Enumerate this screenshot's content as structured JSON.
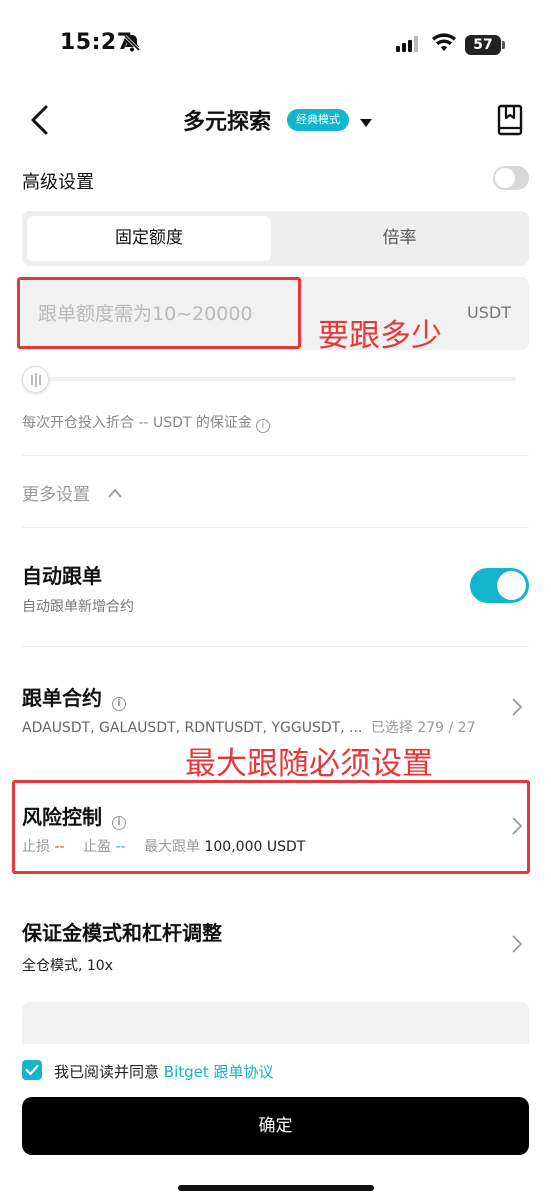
{
  "status": {
    "time": "15:27",
    "battery": "57"
  },
  "header": {
    "title": "多元探索",
    "mode_badge": "经典模式"
  },
  "advanced": {
    "label": "高级设置"
  },
  "tabs": [
    {
      "label": "固定额度"
    },
    {
      "label": "倍率"
    }
  ],
  "amount": {
    "placeholder": "跟单额度需为10~20000",
    "unit": "USDT"
  },
  "annotations": {
    "amount_note": "要跟多少",
    "risk_note": "最大跟随必须设置"
  },
  "margin_info": "每次开仓投入折合 -- USDT 的保证金",
  "more_settings": "更多设置",
  "auto_follow": {
    "title": "自动跟单",
    "subtitle": "自动跟单新增合约",
    "enabled": true
  },
  "contracts": {
    "title": "跟单合约",
    "list": "ADAUSDT, GALAUSDT, RDNTUSDT, YGGUSDT, ...",
    "selected": "已选择 279 / 27"
  },
  "risk": {
    "title": "风险控制",
    "stop_loss_label": "止损",
    "stop_loss_value": "--",
    "take_profit_label": "止盈",
    "take_profit_value": "--",
    "max_follow_label": "最大跟单",
    "max_follow_value": "100,000 USDT"
  },
  "margin_mode": {
    "title": "保证金模式和杠杆调整",
    "value": "全仓模式, 10x"
  },
  "agreement": {
    "prefix": "我已阅读并同意",
    "link": "Bitget 跟单协议",
    "checked": true
  },
  "confirm_label": "确定",
  "colors": {
    "accent": "#12b5cb",
    "annotation": "#e5383b"
  }
}
